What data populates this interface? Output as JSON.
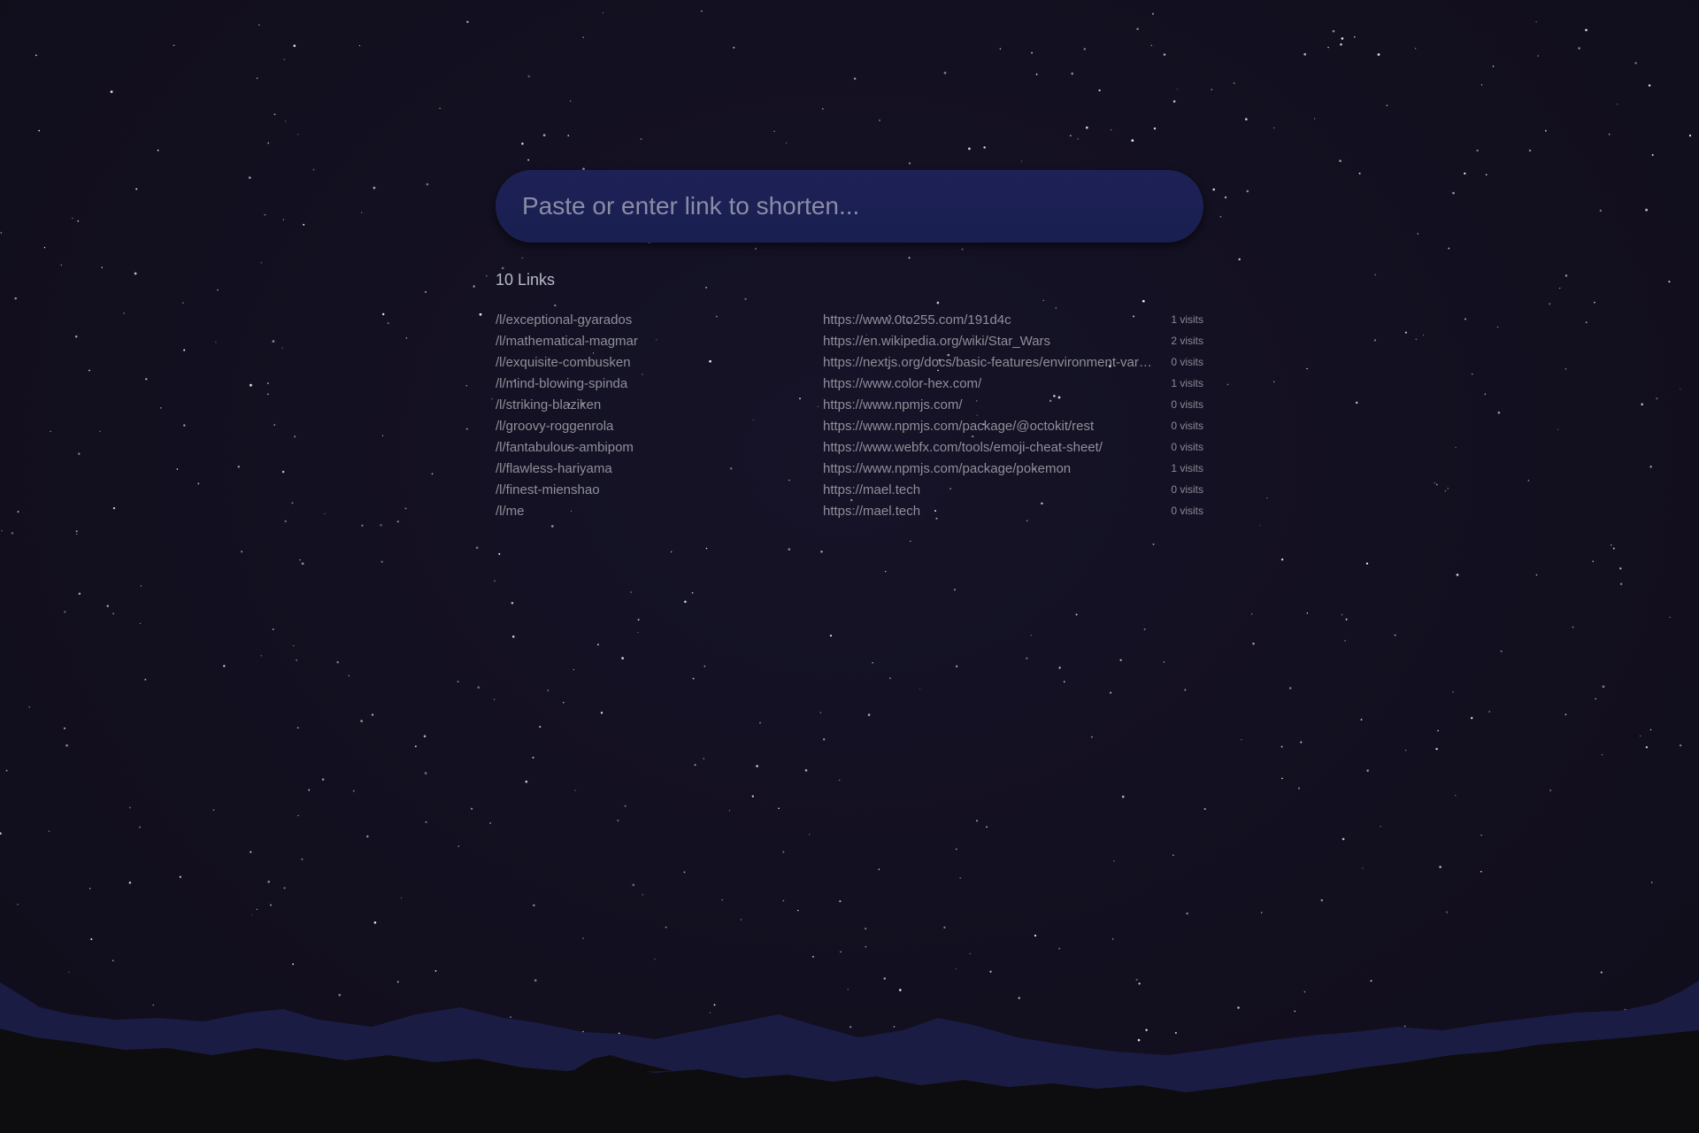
{
  "search": {
    "placeholder": "Paste or enter link to shorten..."
  },
  "links_count": "10 Links",
  "links": [
    {
      "short": "/l/exceptional-gyarados",
      "url": "https://www.0to255.com/191d4c",
      "visits": "1 visits"
    },
    {
      "short": "/l/mathematical-magmar",
      "url": "https://en.wikipedia.org/wiki/Star_Wars",
      "visits": "2 visits"
    },
    {
      "short": "/l/exquisite-combusken",
      "url": "https://nextjs.org/docs/basic-features/environment-variables",
      "visits": "0 visits"
    },
    {
      "short": "/l/mind-blowing-spinda",
      "url": "https://www.color-hex.com/",
      "visits": "1 visits"
    },
    {
      "short": "/l/striking-blaziken",
      "url": "https://www.npmjs.com/",
      "visits": "0 visits"
    },
    {
      "short": "/l/groovy-roggenrola",
      "url": "https://www.npmjs.com/package/@octokit/rest",
      "visits": "0 visits"
    },
    {
      "short": "/l/fantabulous-ambipom",
      "url": "https://www.webfx.com/tools/emoji-cheat-sheet/",
      "visits": "0 visits"
    },
    {
      "short": "/l/flawless-hariyama",
      "url": "https://www.npmjs.com/package/pokemon",
      "visits": "1 visits"
    },
    {
      "short": "/l/finest-mienshao",
      "url": "https://mael.tech",
      "visits": "0 visits"
    },
    {
      "short": "/l/me",
      "url": "https://mael.tech",
      "visits": "0 visits"
    }
  ],
  "colors": {
    "background": "#120f1f",
    "input_bg": "#1d2155",
    "mountain_far": "#1b1c44",
    "mountain_near": "#0d0d0f"
  }
}
